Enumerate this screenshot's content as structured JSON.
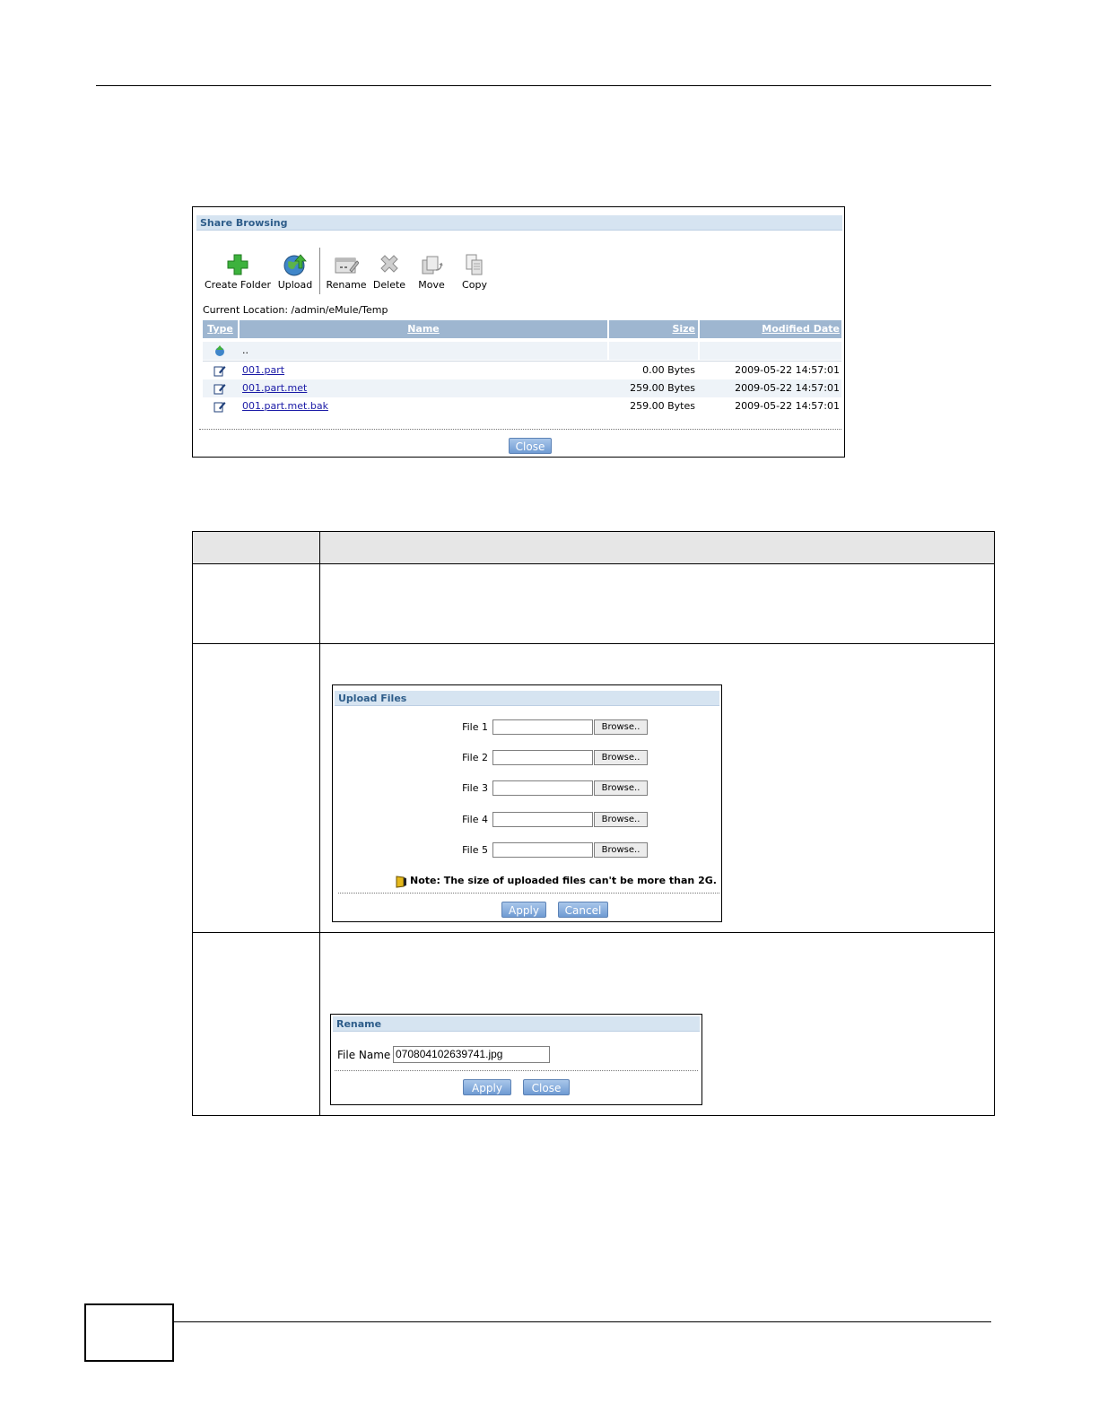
{
  "share_browsing": {
    "title": "Share Browsing",
    "toolbar": {
      "create_folder": "Create Folder",
      "upload": "Upload",
      "rename": "Rename",
      "delete": "Delete",
      "move": "Move",
      "copy": "Copy"
    },
    "current_location": "Current Location: /admin/eMule/Temp",
    "columns": {
      "type": "Type",
      "name": "Name",
      "size": "Size",
      "modified": "Modified Date"
    },
    "parent_row": {
      "name": ".."
    },
    "rows": [
      {
        "name": "001.part",
        "size": "0.00 Bytes",
        "modified": "2009-05-22 14:57:01"
      },
      {
        "name": "001.part.met",
        "size": "259.00 Bytes",
        "modified": "2009-05-22 14:57:01"
      },
      {
        "name": "001.part.met.bak",
        "size": "259.00 Bytes",
        "modified": "2009-05-22 14:57:01"
      }
    ],
    "close_label": "Close"
  },
  "upload_files": {
    "title": "Upload Files",
    "files": [
      {
        "label": "File 1",
        "browse": "Browse.."
      },
      {
        "label": "File 2",
        "browse": "Browse.."
      },
      {
        "label": "File 3",
        "browse": "Browse.."
      },
      {
        "label": "File 4",
        "browse": "Browse.."
      },
      {
        "label": "File 5",
        "browse": "Browse.."
      }
    ],
    "note": "Note: The size of uploaded files can't be more than 2G.",
    "apply_label": "Apply",
    "cancel_label": "Cancel"
  },
  "rename": {
    "title": "Rename",
    "file_name_label": "File Name",
    "file_name_value": "070804102639741.jpg",
    "apply_label": "Apply",
    "close_label": "Close"
  },
  "colors": {
    "title_bar": "#d6e4f1",
    "header": "#9eb6d0",
    "button": "#6f9bd3",
    "link": "#1a1aa6"
  }
}
